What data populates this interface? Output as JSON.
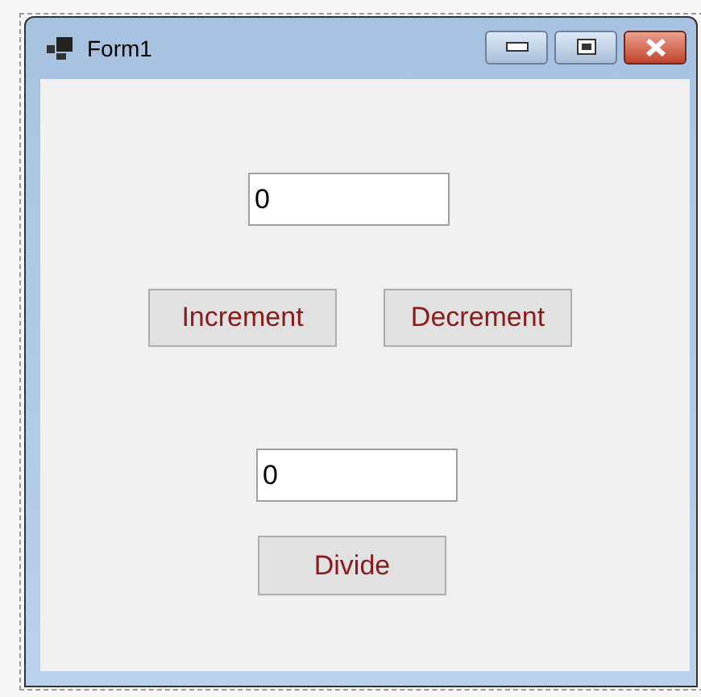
{
  "window": {
    "title": "Form1"
  },
  "controls": [
    {
      "kind": "textbox",
      "value": "0"
    },
    {
      "kind": "button",
      "label": "Increment"
    },
    {
      "kind": "button",
      "label": "Decrement"
    },
    {
      "kind": "textbox",
      "value": "0"
    },
    {
      "kind": "button",
      "label": "Divide"
    }
  ]
}
